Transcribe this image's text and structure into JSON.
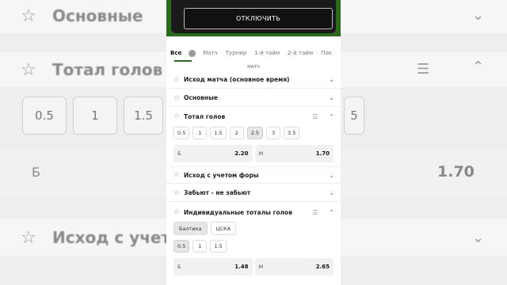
{
  "background": {
    "rows": [
      "Основные",
      "Тотал голов",
      "Исход с учетом"
    ],
    "chips": [
      "0.5",
      "1",
      "1.5",
      "5"
    ],
    "under_label": "Б",
    "value": "1.70"
  },
  "topbar": {
    "button_label": "ОТКЛЮЧИТЬ"
  },
  "tabs": [
    {
      "label": "Все",
      "active": true
    },
    {
      "label": "Матч"
    },
    {
      "label": "Турнир"
    },
    {
      "label": "1-й тайм"
    },
    {
      "label": "2-й тайм"
    },
    {
      "label": "Пок"
    }
  ],
  "section_label": "МАТЧ",
  "markets": {
    "m1": "Исход матча (основное время)",
    "m2": "Основные",
    "m3": "Тотал голов",
    "m4": "Исход с учетом форы",
    "m5": "Забьют - не забьют",
    "m6": "Индивидуальные тоталы голов"
  },
  "total_chips": [
    "0.5",
    "1",
    "1.5",
    "2",
    "2.5",
    "3",
    "3.5"
  ],
  "total_selected": "2.5",
  "total_odds": {
    "under_label": "Б",
    "under": "2.20",
    "over_label": "М",
    "over": "1.70"
  },
  "teams": [
    "Балтика",
    "ЦСКА"
  ],
  "team_selected": "Балтика",
  "ind_chips": [
    "0.5",
    "1",
    "1.5"
  ],
  "ind_selected": "0.5",
  "ind_odds": {
    "under_label": "Б",
    "under": "1.48",
    "over_label": "М",
    "over": "2.65"
  },
  "colors": {
    "accent": "#2b6a1c",
    "panel": "#ffffff",
    "chip_selected": "#e6e6e6"
  }
}
